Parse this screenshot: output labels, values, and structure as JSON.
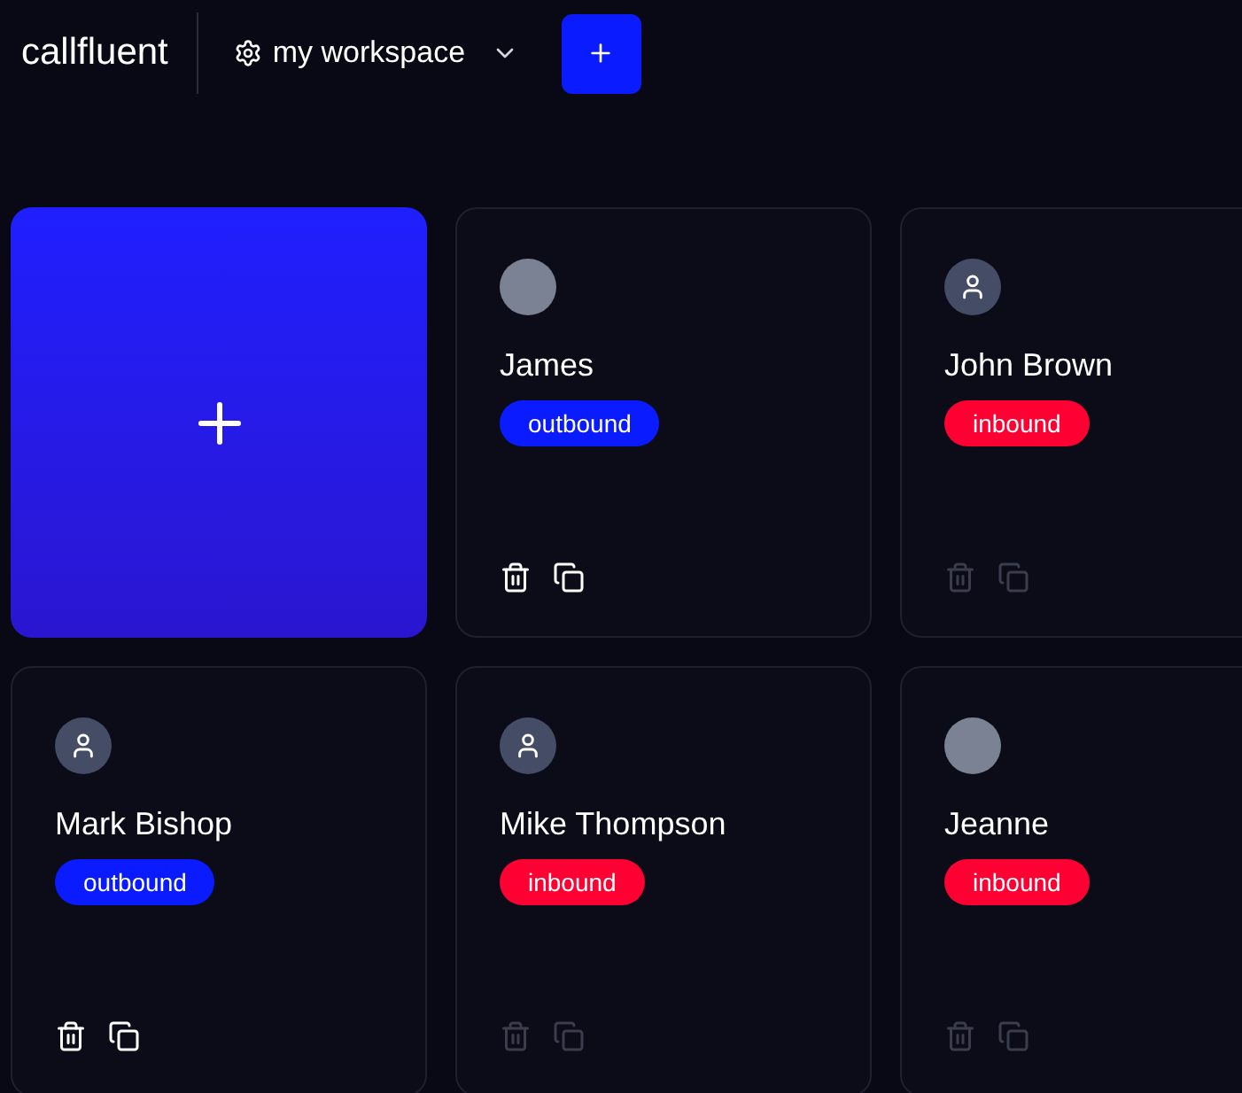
{
  "header": {
    "logo": "callfluent",
    "workspace": "my workspace"
  },
  "cards": [
    {
      "kind": "new"
    },
    {
      "kind": "agent",
      "name": "James",
      "avatar": {
        "kind": "photo"
      },
      "tag": {
        "label": "outbound",
        "color": "#0a1cff"
      },
      "actions_dimmed": false
    },
    {
      "kind": "agent",
      "name": "John Brown",
      "avatar": {
        "kind": "placeholder"
      },
      "tag": {
        "label": "inbound",
        "color": "#ff0033"
      },
      "actions_dimmed": true
    },
    {
      "kind": "agent",
      "name": "Mark Bishop",
      "avatar": {
        "kind": "placeholder"
      },
      "tag": {
        "label": "outbound",
        "color": "#0a1cff"
      },
      "actions_dimmed": false
    },
    {
      "kind": "agent",
      "name": "Mike Thompson",
      "avatar": {
        "kind": "placeholder"
      },
      "tag": {
        "label": "inbound",
        "color": "#ff0033"
      },
      "actions_dimmed": true
    },
    {
      "kind": "agent",
      "name": "Jeanne",
      "avatar": {
        "kind": "photo"
      },
      "tag": {
        "label": "inbound",
        "color": "#ff0033"
      },
      "actions_dimmed": true
    }
  ]
}
